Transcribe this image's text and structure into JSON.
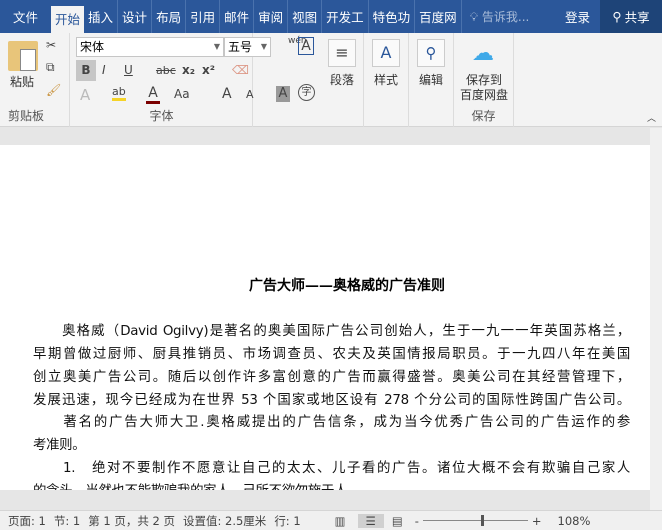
{
  "tabs": {
    "file": "文件",
    "items": [
      "开始",
      "插入",
      "设计",
      "布局",
      "引用",
      "邮件",
      "审阅",
      "视图",
      "开发工",
      "特色功",
      "百度网"
    ],
    "tell_me": "告诉我...",
    "login": "登录",
    "share": "共享"
  },
  "ribbon": {
    "clipboard": {
      "paste": "粘贴",
      "label": "剪贴板"
    },
    "font": {
      "name": "宋体",
      "size": "五号",
      "label": "字体",
      "bold": "B",
      "italic": "I",
      "underline": "U",
      "strike": "abc",
      "sub": "x₂",
      "sup": "x²",
      "case": "Aa",
      "grow": "A",
      "shrink": "A",
      "phonetic": "wén",
      "char_border": "A",
      "enclose": "字",
      "font_color": "#7b0000",
      "highlight_color": "#f5d327"
    },
    "paragraph": {
      "label": "段落"
    },
    "styles": {
      "label": "样式"
    },
    "editing": {
      "label": "编辑"
    },
    "save": {
      "line1": "保存到",
      "line2": "百度网盘",
      "label": "保存"
    }
  },
  "document": {
    "title": "广告大师——奥格威的广告准则",
    "lines": [
      "　　奥格威（David Ogilvy)是著名的奥美国际广告公司创始人，生于一九一一年英国苏格兰，",
      "早期曾做过厨师、厨具推销员、市场调查员、农夫及英国情报局职员。于一九四八年在美国",
      "创立奥美广告公司。随后以创作许多富创意的广告而赢得盛誉。奥美公司在其经营管理下，",
      "发展迅速，现今已经成为在世界 53 个国家或地区设有 278 个分公司的国际性跨国广告公司。",
      "　　著名的广告大师大卫.奥格威提出的广告信条，成为当今优秀广告公司的广告运作的参",
      "考准则。",
      "　　1.　绝对不要制作不愿意让自己的太太、儿子看的广告。诸位大概不会有欺骗自己家人",
      "的念头，当然也不能欺骗我的家人，己所不欲勿施于人。"
    ]
  },
  "status": {
    "page": "页面: 1",
    "section": "节: 1",
    "page_of": "第 1 页，共 2 页",
    "setting": "设置值: 2.5厘米",
    "row": "行: 1",
    "zoom": "108%",
    "zoom_level_percent": 108
  },
  "colors": {
    "brand": "#2b579a"
  }
}
